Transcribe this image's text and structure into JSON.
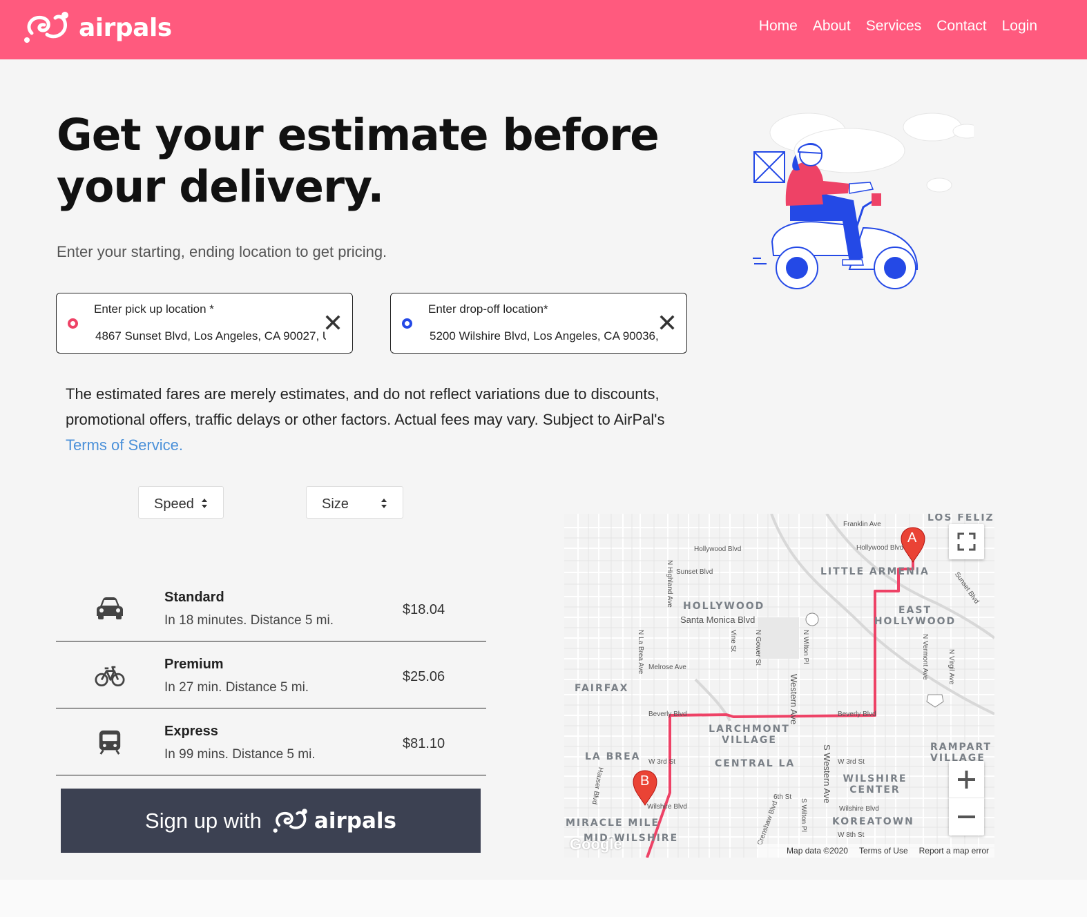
{
  "brand": {
    "name": "airpals",
    "color": "#ff5a7e"
  },
  "nav": {
    "links": [
      "Home",
      "About",
      "Services",
      "Contact",
      "Login"
    ]
  },
  "hero": {
    "headline": "Get your estimate before your delivery.",
    "subhead": "Enter your starting, ending location to get pricing."
  },
  "pickup": {
    "label": "Enter pick up location *",
    "value": "4867 Sunset Blvd, Los Angeles, CA 90027, U"
  },
  "dropoff": {
    "label": "Enter drop-off location*",
    "value": "5200 Wilshire Blvd, Los Angeles, CA 90036, U"
  },
  "disclaimer": {
    "text": "The estimated fares are merely estimates, and do not reflect variations due to discounts, promotional offers, traffic delays or other factors. Actual fees may vary. Subject to AirPal's ",
    "link": "Terms of Service."
  },
  "filters": {
    "speed": "Speed",
    "size": "Size"
  },
  "fares": [
    {
      "name": "Standard",
      "detail": "In 18 minutes. Distance 5 mi.",
      "price": "$18.04",
      "icon": "car-icon"
    },
    {
      "name": "Premium",
      "detail": "In 27 min. Distance 5 mi.",
      "price": "$25.06",
      "icon": "bicycle-icon"
    },
    {
      "name": "Express",
      "detail": "In 99 mins. Distance 5 mi.",
      "price": "$81.10",
      "icon": "train-icon"
    }
  ],
  "signup": {
    "label": "Sign up with",
    "brand": "airpals"
  },
  "map": {
    "markers": [
      "A",
      "B"
    ],
    "neighborhoods": [
      "LOS FELIZ",
      "LITTLE ARMENIA",
      "HOLLYWOOD",
      "EAST HOLLYWOOD",
      "FAIRFAX",
      "LARCHMONT VILLAGE",
      "LA BREA",
      "CENTRAL LA",
      "WILSHIRE CENTER",
      "RAMPART VILLAGE",
      "KOREATOWN",
      "MIRACLE MILE",
      "MID-WILSHIRE"
    ],
    "streets": [
      "Franklin Ave",
      "Hollywood Blvd",
      "Hollywood Blvd",
      "Sunset Blvd",
      "Sunset Blvd",
      "Santa Monica Blvd",
      "Melrose Ave",
      "Beverly Blvd",
      "Beverly Blvd",
      "W 3rd St",
      "W 3rd St",
      "Wilshire Blvd",
      "Wilshire Blvd",
      "6th St",
      "W 8th St",
      "Western Ave",
      "S Western Ave",
      "N Highland Ave",
      "N La Brea Ave",
      "Vine St",
      "N Gower St",
      "N Wilton Pl",
      "S Wilton Pl",
      "N Vermont Ave",
      "N Virgil Ave",
      "Hauser Blvd",
      "Crenshaw Blvd"
    ],
    "footer": [
      "Map data ©2020",
      "Terms of Use",
      "Report a map error"
    ],
    "attribution": "Google",
    "route_color": "#ee4266",
    "marker_color": "#ea4335"
  }
}
